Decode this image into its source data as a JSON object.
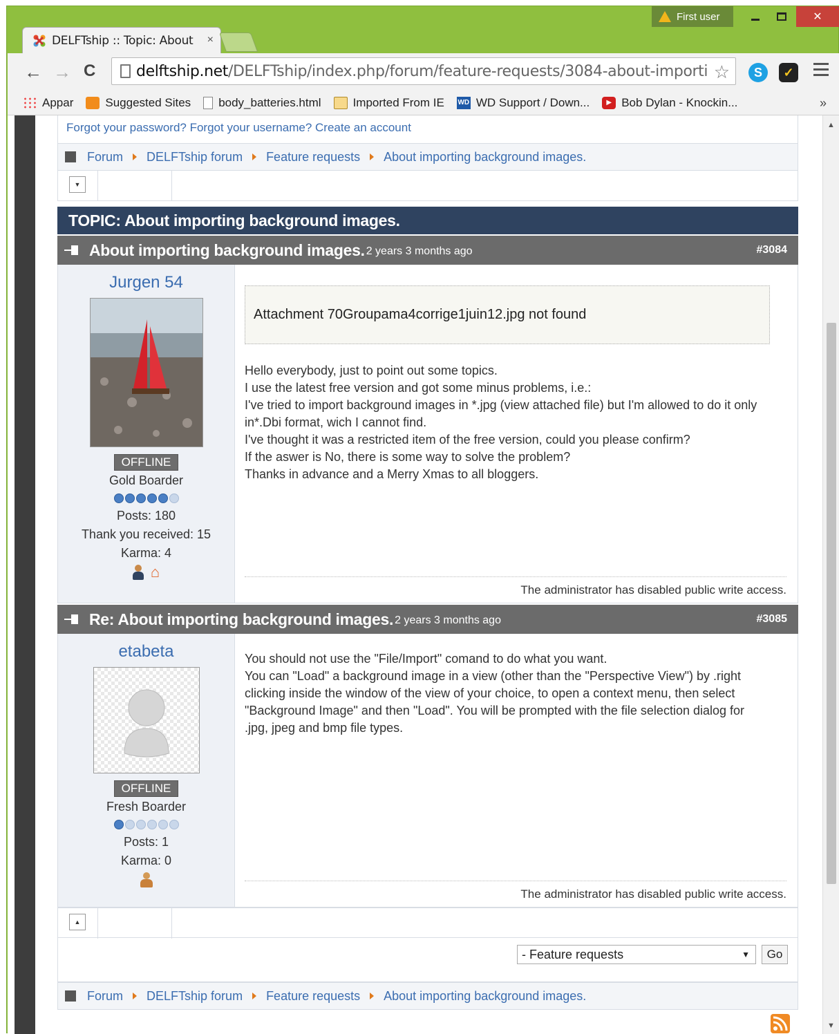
{
  "browser": {
    "tab_title": "DELFTship :: Topic: About",
    "tab_close": "×",
    "user_badge": "First user",
    "url_host": "delftship.net",
    "url_path": "/DELFTship/index.php/forum/feature-requests/3084-about-importi",
    "bookmarks": [
      "Appar",
      "Suggested Sites",
      "body_batteries.html",
      "Imported From IE",
      "WD Support / Down...",
      "Bob Dylan - Knockin..."
    ],
    "bookmarks_more": "»"
  },
  "page": {
    "login_links": "Forgot your password? Forgot your username? Create an account",
    "breadcrumb": [
      "Forum",
      "DELFTship forum",
      "Feature requests",
      "About importing background images."
    ],
    "topic_header": "TOPIC: About importing background images.",
    "posts": [
      {
        "title": "About importing background images.",
        "ago": "2 years 3 months ago",
        "id": "#3084",
        "author": "Jurgen 54",
        "status": "OFFLINE",
        "rank": "Gold Boarder",
        "rank_level": 5,
        "posts": "Posts: 180",
        "thanks": "Thank you received: 15",
        "karma": "Karma: 4",
        "attachment": "Attachment 70Groupama4corrige1juin12.jpg not found",
        "lines": [
          "Hello everybody, just to point out some topics.",
          "I use the latest free version and got some minus problems, i.e.:",
          "I've tried to import background images in *.jpg (view attached file) but I'm allowed to do it only in*.Dbi format, wich I cannot find.",
          "I've thought it was a restricted item of the free version, could you please confirm?",
          "If the aswer is No, there is some way to solve the problem?",
          "Thanks in advance and a Merry Xmas to all bloggers."
        ],
        "footer": "The administrator has disabled public write access."
      },
      {
        "title": "Re: About importing background images.",
        "ago": "2 years 3 months ago",
        "id": "#3085",
        "author": "etabeta",
        "status": "OFFLINE",
        "rank": "Fresh Boarder",
        "rank_level": 1,
        "posts": "Posts: 1",
        "karma": "Karma: 0",
        "lines": [
          "You should not use the \"File/Import\" comand to do what you want.",
          "You can \"Load\" a background image in a view (other than the \"Perspective View\") by .right clicking inside the window of the view of your choice, to open a context menu, then select \"Background Image\" and then \"Load\". You will be prompted with the file selection dialog for .jpg, jpeg and bmp file types."
        ],
        "footer": "The administrator has disabled public write access."
      }
    ],
    "jump_select": "- Feature requests",
    "go_button": "Go"
  }
}
